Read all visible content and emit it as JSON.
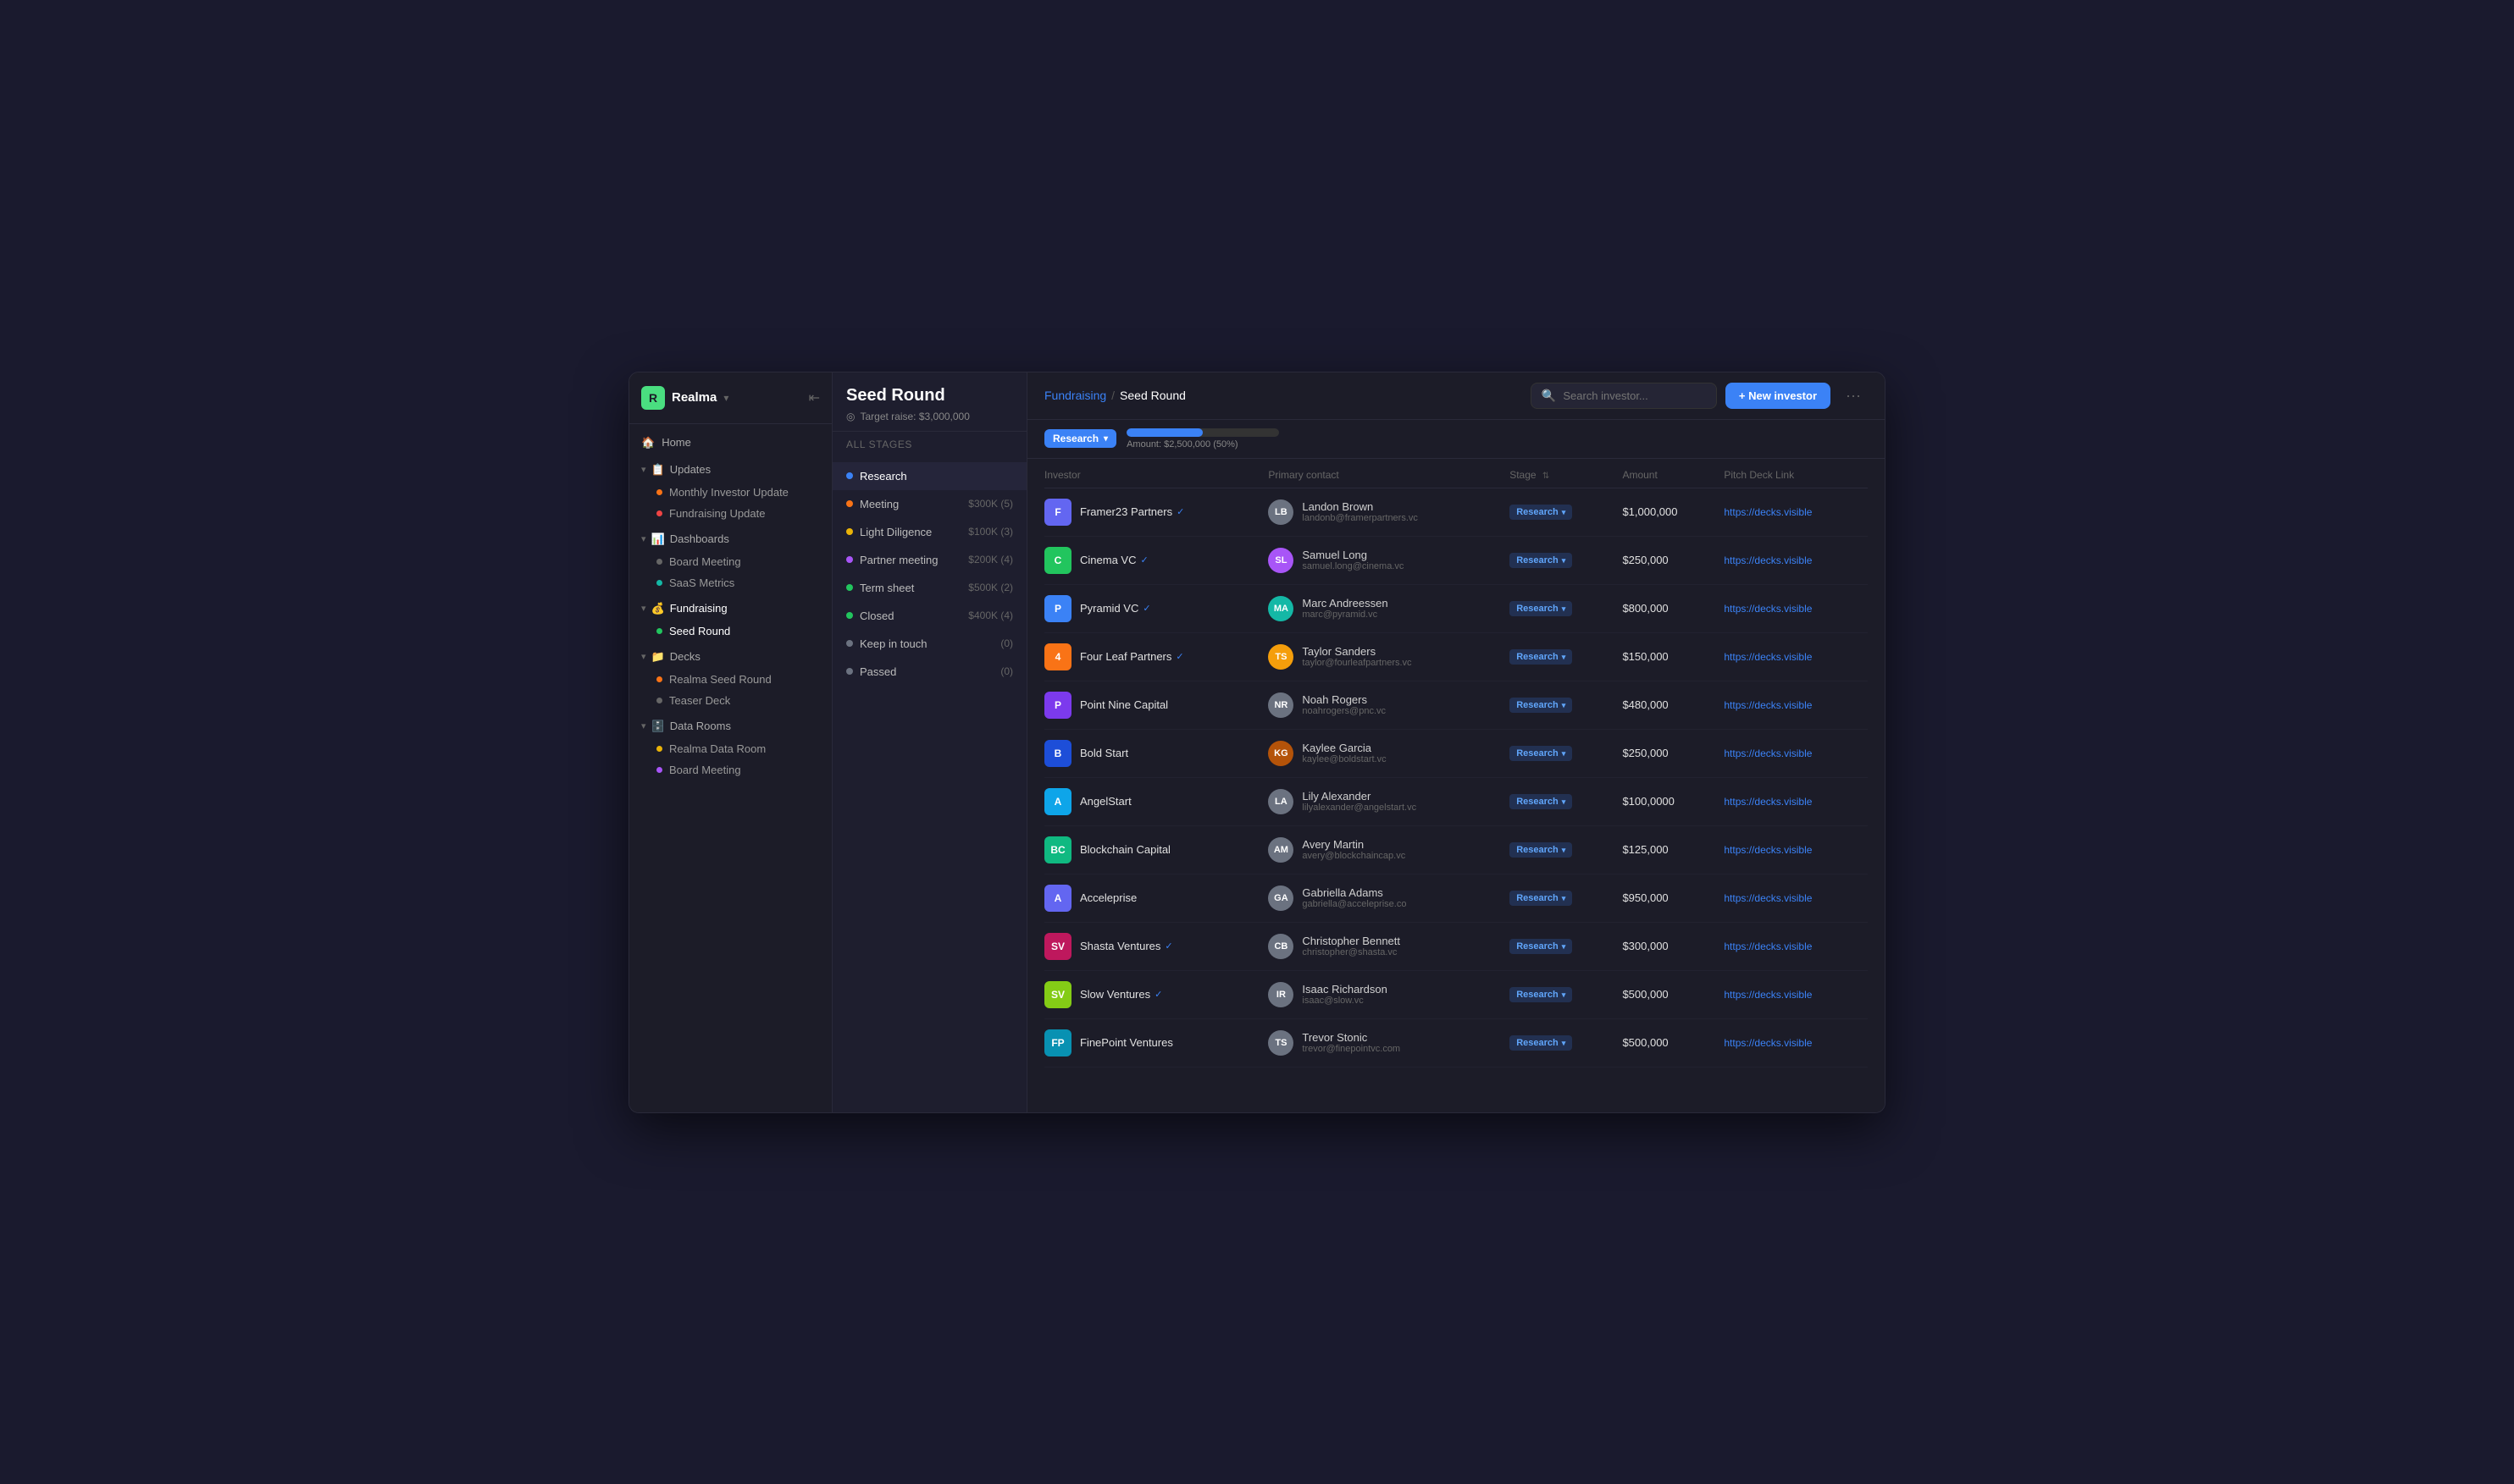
{
  "app": {
    "name": "Realma",
    "logo_char": "R"
  },
  "sidebar": {
    "home_label": "Home",
    "sections": [
      {
        "name": "Updates",
        "icon": "📋",
        "items": [
          {
            "label": "Monthly Investor Update",
            "dot": "orange"
          },
          {
            "label": "Fundraising Update",
            "dot": "red"
          }
        ]
      },
      {
        "name": "Dashboards",
        "icon": "📊",
        "items": [
          {
            "label": "Board Meeting",
            "dot": "none"
          },
          {
            "label": "SaaS Metrics",
            "dot": "teal"
          }
        ]
      },
      {
        "name": "Fundraising",
        "icon": "💰",
        "items": [
          {
            "label": "Seed Round",
            "dot": "green",
            "active": true
          }
        ]
      },
      {
        "name": "Decks",
        "icon": "📁",
        "items": [
          {
            "label": "Realma Seed Round",
            "dot": "orange"
          },
          {
            "label": "Teaser Deck",
            "dot": "none"
          }
        ]
      },
      {
        "name": "Data Rooms",
        "icon": "🗄️",
        "items": [
          {
            "label": "Realma Data Room",
            "dot": "yellow"
          },
          {
            "label": "Board Meeting",
            "dot": "purple"
          }
        ]
      }
    ]
  },
  "stage_panel": {
    "title": "Seed Round",
    "target_label": "Target raise: $3,000,000",
    "all_stages_label": "All stages",
    "stages": [
      {
        "name": "Research",
        "dot": "blue",
        "amount": "",
        "count": "",
        "active": true
      },
      {
        "name": "Meeting",
        "dot": "orange",
        "amount": "$300K",
        "count": "(5)"
      },
      {
        "name": "Light Diligence",
        "dot": "yellow",
        "amount": "$100K",
        "count": "(3)"
      },
      {
        "name": "Partner meeting",
        "dot": "purple",
        "amount": "$200K",
        "count": "(4)"
      },
      {
        "name": "Term sheet",
        "dot": "green",
        "amount": "$500K",
        "count": "(2)"
      },
      {
        "name": "Closed",
        "dot": "green",
        "amount": "$400K",
        "count": "(4)"
      },
      {
        "name": "Keep in touch",
        "dot": "gray",
        "amount": "",
        "count": "(0)"
      },
      {
        "name": "Passed",
        "dot": "gray",
        "amount": "",
        "count": "(0)"
      }
    ]
  },
  "header": {
    "breadcrumb_fundraising": "Fundraising",
    "breadcrumb_sep": "/",
    "breadcrumb_current": "Seed Round",
    "search_placeholder": "Search investor...",
    "new_investor_label": "+ New investor",
    "more_icon": "···"
  },
  "filter_bar": {
    "filter_label": "Research",
    "progress_label": "Amount: $2,500,000 (50%)",
    "progress_percent": 50
  },
  "table": {
    "columns": [
      {
        "label": "Investor"
      },
      {
        "label": "Primary contact"
      },
      {
        "label": "Stage",
        "sortable": true
      },
      {
        "label": "Amount"
      },
      {
        "label": "Pitch Deck Link"
      }
    ],
    "rows": [
      {
        "investor_name": "Framer23 Partners",
        "investor_verified": true,
        "investor_avatar_bg": "#6366f1",
        "investor_avatar_char": "F",
        "investor_avatar_img": "framer23",
        "contact_name": "Landon Brown",
        "contact_email": "landonb@framerpartners.vc",
        "contact_avatar_bg": "#6b7280",
        "contact_avatar_initials": "LB",
        "stage": "Research",
        "amount": "$1,000,000",
        "pitch_link": "https://decks.visible"
      },
      {
        "investor_name": "Cinema VC",
        "investor_verified": true,
        "investor_avatar_bg": "#22c55e",
        "investor_avatar_char": "C",
        "contact_name": "Samuel Long",
        "contact_email": "samuel.long@cinema.vc",
        "contact_avatar_bg": "#a855f7",
        "contact_avatar_initials": "SL",
        "stage": "Research",
        "amount": "$250,000",
        "pitch_link": "https://decks.visible"
      },
      {
        "investor_name": "Pyramid VC",
        "investor_verified": true,
        "investor_avatar_bg": "#3b82f6",
        "investor_avatar_char": "P",
        "contact_name": "Marc Andreessen",
        "contact_email": "marc@pyramid.vc",
        "contact_avatar_bg": "#14b8a6",
        "contact_avatar_initials": "MA",
        "stage": "Research",
        "amount": "$800,000",
        "pitch_link": "https://decks.visible"
      },
      {
        "investor_name": "Four Leaf Partners",
        "investor_verified": true,
        "investor_avatar_bg": "#f97316",
        "investor_avatar_char": "4",
        "contact_name": "Taylor Sanders",
        "contact_email": "taylor@fourleafpartners.vc",
        "contact_avatar_bg": "#f59e0b",
        "contact_avatar_initials": "TS",
        "stage": "Research",
        "amount": "$150,000",
        "pitch_link": "https://decks.visible"
      },
      {
        "investor_name": "Point Nine Capital",
        "investor_verified": false,
        "investor_avatar_bg": "#7c3aed",
        "investor_avatar_char": "P",
        "contact_name": "Noah Rogers",
        "contact_email": "noahrogers@pnc.vc",
        "contact_avatar_bg": "#6b7280",
        "contact_avatar_initials": "NR",
        "stage": "Research",
        "amount": "$480,000",
        "pitch_link": "https://decks.visible"
      },
      {
        "investor_name": "Bold Start",
        "investor_verified": false,
        "investor_avatar_bg": "#1d4ed8",
        "investor_avatar_char": "B",
        "contact_name": "Kaylee Garcia",
        "contact_email": "kaylee@boldstart.vc",
        "contact_avatar_bg": "#b45309",
        "contact_avatar_initials": "KG",
        "stage": "Research",
        "amount": "$250,000",
        "pitch_link": "https://decks.visible"
      },
      {
        "investor_name": "AngelStart",
        "investor_verified": false,
        "investor_avatar_bg": "#0ea5e9",
        "investor_avatar_char": "A",
        "contact_name": "Lily Alexander",
        "contact_email": "lilyalexander@angelstart.vc",
        "contact_avatar_bg": "#6b7280",
        "contact_avatar_initials": "LA",
        "stage": "Research",
        "amount": "$100,0000",
        "pitch_link": "https://decks.visible"
      },
      {
        "investor_name": "Blockchain Capital",
        "investor_verified": false,
        "investor_avatar_bg": "#10b981",
        "investor_avatar_char": "BC",
        "contact_name": "Avery Martin",
        "contact_email": "avery@blockchaincap.vc",
        "contact_avatar_bg": "#6b7280",
        "contact_avatar_initials": "AM",
        "stage": "Research",
        "amount": "$125,000",
        "pitch_link": "https://decks.visible"
      },
      {
        "investor_name": "Acceleprise",
        "investor_verified": false,
        "investor_avatar_bg": "#6366f1",
        "investor_avatar_char": "A",
        "contact_name": "Gabriella Adams",
        "contact_email": "gabriella@acceleprise.co",
        "contact_avatar_bg": "#6b7280",
        "contact_avatar_initials": "GA",
        "stage": "Research",
        "amount": "$950,000",
        "pitch_link": "https://decks.visible"
      },
      {
        "investor_name": "Shasta Ventures",
        "investor_verified": true,
        "investor_avatar_bg": "#be185d",
        "investor_avatar_char": "SV",
        "contact_name": "Christopher Bennett",
        "contact_email": "christopher@shasta.vc",
        "contact_avatar_bg": "#6b7280",
        "contact_avatar_initials": "CB",
        "stage": "Research",
        "amount": "$300,000",
        "pitch_link": "https://decks.visible"
      },
      {
        "investor_name": "Slow Ventures",
        "investor_verified": true,
        "investor_avatar_bg": "#84cc16",
        "investor_avatar_char": "SV",
        "contact_name": "Isaac Richardson",
        "contact_email": "isaac@slow.vc",
        "contact_avatar_bg": "#6b7280",
        "contact_avatar_initials": "IR",
        "stage": "Research",
        "amount": "$500,000",
        "pitch_link": "https://decks.visible"
      },
      {
        "investor_name": "FinePoint Ventures",
        "investor_verified": false,
        "investor_avatar_bg": "#0891b2",
        "investor_avatar_char": "FP",
        "contact_name": "Trevor Stonic",
        "contact_email": "trevor@finepointvc.com",
        "contact_avatar_bg": "#6b7280",
        "contact_avatar_initials": "TS",
        "stage": "Research",
        "amount": "$500,000",
        "pitch_link": "https://decks.visible"
      }
    ]
  }
}
